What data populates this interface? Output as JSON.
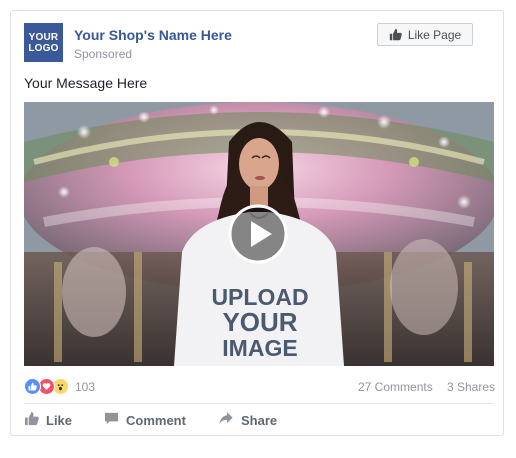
{
  "post": {
    "logo_text": "YOUR\nLOGO",
    "page_name": "Your Shop's Name Here",
    "sponsored_label": "Sponsored",
    "like_page_label": "Like Page",
    "message": "Your Message Here"
  },
  "media": {
    "shirt_text_line1": "UPLOAD",
    "shirt_text_line2": "YOUR",
    "shirt_text_line3": "IMAGE",
    "play_icon": "play-icon"
  },
  "stats": {
    "reaction_count": "103",
    "comments": "27 Comments",
    "shares": "3 Shares"
  },
  "actions": {
    "like": "Like",
    "comment": "Comment",
    "share": "Share"
  },
  "colors": {
    "brand_blue": "#3b5998",
    "link_blue": "#365899",
    "like_reaction": "#5890ff",
    "love_reaction": "#f25268",
    "wow_reaction": "#fcd765"
  }
}
